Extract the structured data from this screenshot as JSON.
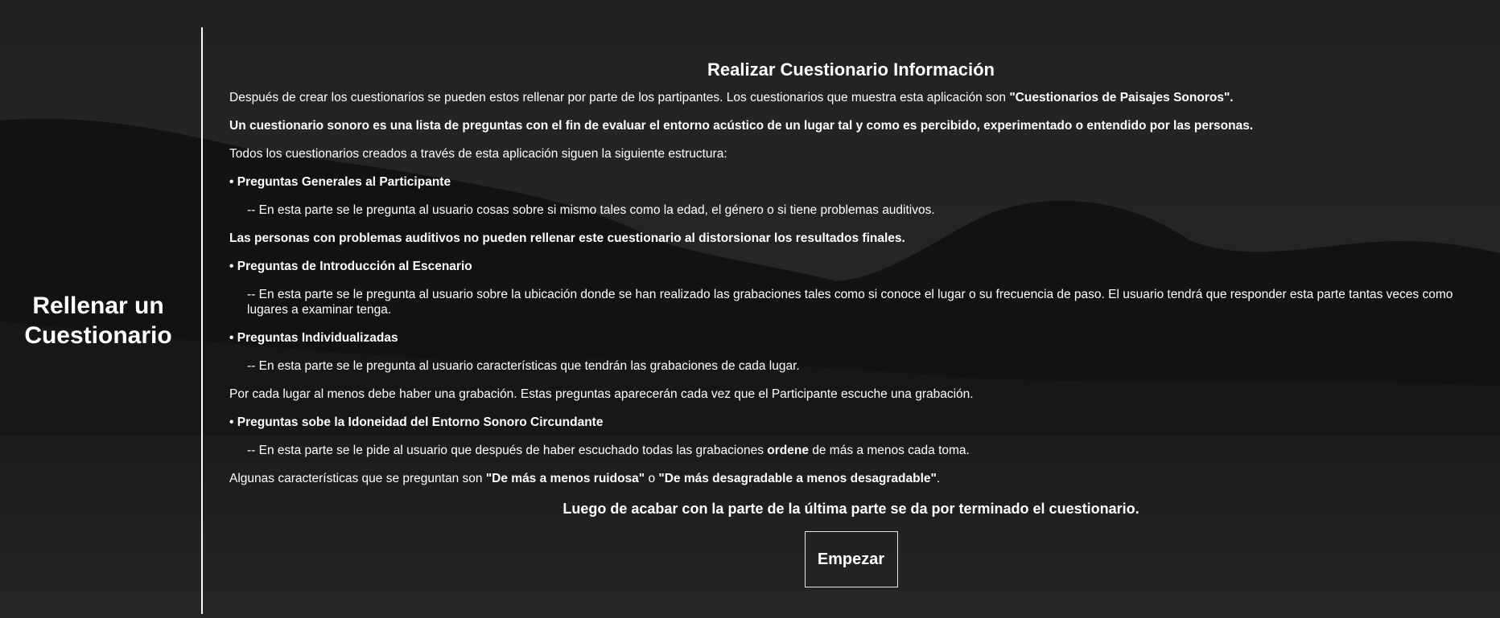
{
  "colors": {
    "background": "#1e1e1e",
    "text": "#ffffff",
    "divider": "#ffffff",
    "button_border": "#e6e6e6"
  },
  "sidebar": {
    "title_line1": "Rellenar un",
    "title_line2": "Cuestionario"
  },
  "main": {
    "title": "Realizar Cuestionario Información",
    "intro_text": "Después de crear los cuestionarios se pueden estos rellenar por parte de los partipantes. Los cuestionarios que muestra esta aplicación son ",
    "intro_bold": "\"Cuestionarios de Paisajes Sonoros\".",
    "definition": "Un cuestionario sonoro es una lista de preguntas con el fin de evaluar el entorno acústico de un lugar tal y como es percibido, experimentado o entendido por las personas.",
    "structure_intro": "Todos los cuestionarios creados a través de esta aplicación siguen la siguiente estructura:",
    "section1_title": "• Preguntas Generales al Participante",
    "section1_desc": "-- En esta parte se le pregunta al usuario cosas sobre si mismo tales como la edad, el género o si tiene problemas auditivos.",
    "section1_warning": "Las personas con problemas auditivos no pueden rellenar este cuestionario al distorsionar los resultados finales.",
    "section2_title": "• Preguntas de Introducción al Escenario",
    "section2_desc": "-- En esta parte se le pregunta al usuario sobre la ubicación donde se han realizado las grabaciones tales como si conoce el lugar o su frecuencia de paso. El usuario tendrá que responder esta parte tantas veces como lugares a examinar tenga.",
    "section3_title": "• Preguntas Individualizadas",
    "section3_desc": "-- En esta parte se le pregunta al usuario características que tendrán las grabaciones de cada lugar.",
    "section3_note": "Por cada lugar al menos debe haber una grabación. Estas preguntas aparecerán cada vez que el Participante escuche una grabación.",
    "section4_title": "• Preguntas sobe la Idoneidad del Entorno Sonoro Circundante",
    "section4_desc_pre": "-- En esta parte se le pide al usuario que después de haber escuchado todas las grabaciones ",
    "section4_desc_bold": "ordene",
    "section4_desc_post": " de más a menos cada toma.",
    "examples_pre": "Algunas características que se preguntan son ",
    "examples_bold1": "\"De más a menos ruidosa\"",
    "examples_mid": " o ",
    "examples_bold2": "\"De más desagradable a menos desagradable\"",
    "examples_post": ".",
    "closing": "Luego de acabar con la parte de la última parte se da por terminado el cuestionario.",
    "start_button": "Empezar"
  }
}
